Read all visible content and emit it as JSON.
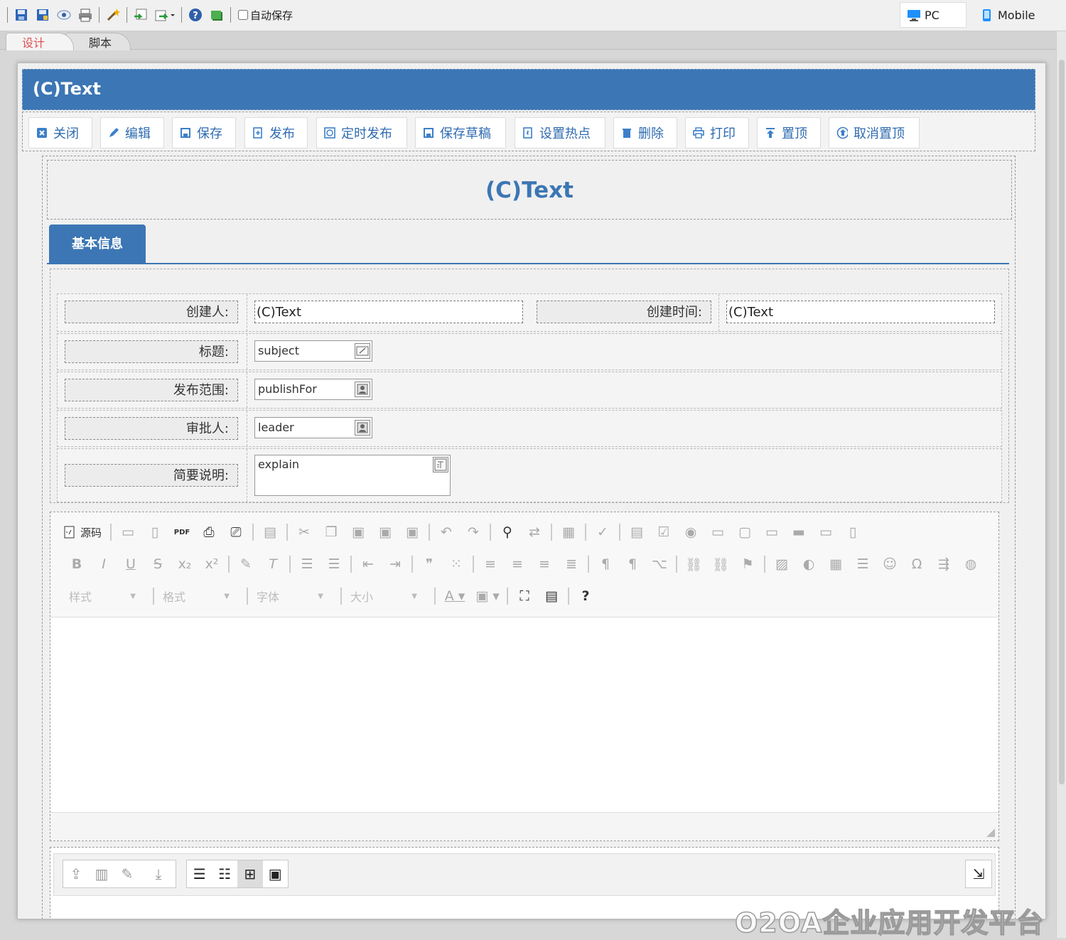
{
  "topbar": {
    "autosave_label": "自动保存",
    "icons": [
      "save-icon",
      "save-as-icon",
      "preview-icon",
      "print-icon",
      "wand-icon",
      "import-icon",
      "export-icon",
      "help-icon",
      "script-icon"
    ],
    "devices": {
      "pc_label": "PC",
      "mobile_label": "Mobile"
    }
  },
  "tabs": {
    "design": "设计",
    "script": "脚本"
  },
  "form": {
    "header_title": "(C)Text",
    "toolbar": [
      "关闭",
      "编辑",
      "保存",
      "发布",
      "定时发布",
      "保存草稿",
      "设置热点",
      "删除",
      "打印",
      "置顶",
      "取消置顶"
    ],
    "title": "(C)Text",
    "section_tab": "基本信息",
    "fields": {
      "creator_label": "创建人:",
      "creator_value": "(C)Text",
      "create_time_label": "创建时间:",
      "create_time_value": "(C)Text",
      "subject_label": "标题:",
      "subject_value": "subject",
      "publish_label": "发布范围:",
      "publish_value": "publishFor",
      "leader_label": "审批人:",
      "leader_value": "leader",
      "explain_label": "简要说明:",
      "explain_value": "explain"
    }
  },
  "editor": {
    "source_label": "源码",
    "combos": {
      "style": "样式",
      "format": "格式",
      "font": "字体",
      "size": "大小"
    }
  },
  "watermark": "O2OA企业应用开发平台",
  "colors": {
    "accent": "#3c76b4",
    "header_bg": "#3c76b4"
  }
}
